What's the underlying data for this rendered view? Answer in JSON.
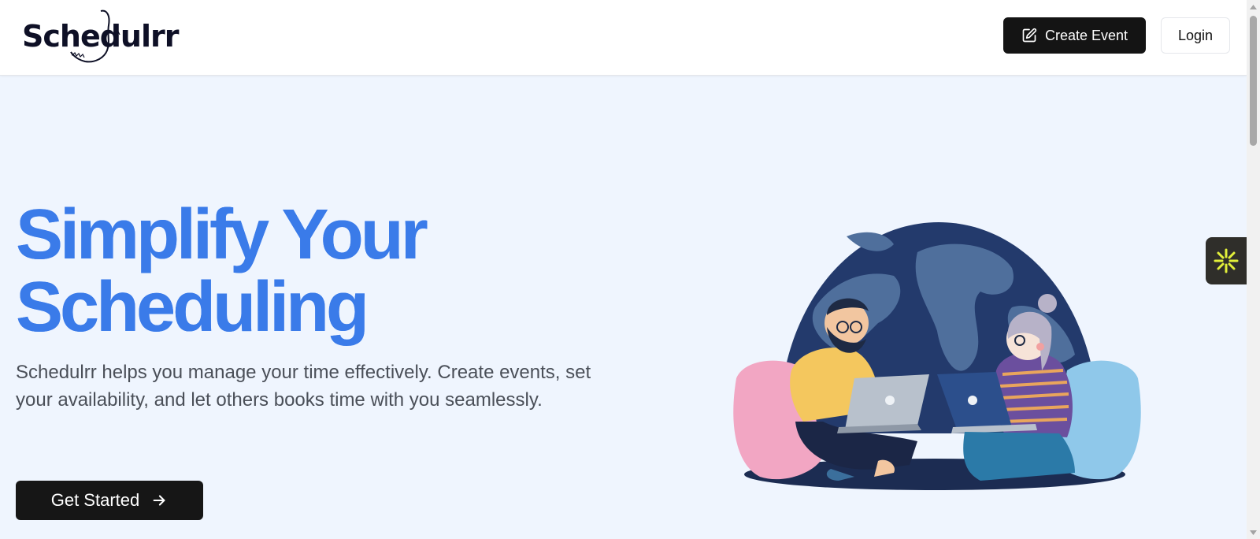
{
  "header": {
    "logo_text": "Schedulrr",
    "create_event_label": "Create Event",
    "login_label": "Login"
  },
  "hero": {
    "title_line1": "Simplify Your",
    "title_line2": "Scheduling",
    "description": "Schedulrr helps you manage your time effectively. Create events, set your availability, and let others books time with you seamlessly.",
    "cta_label": "Get Started"
  },
  "icons": {
    "create_event": "edit-icon",
    "cta_arrow": "arrow-right-icon",
    "side_widget": "asterisk-icon",
    "scroll_up": "chevron-up-icon",
    "scroll_down": "chevron-down-icon"
  },
  "colors": {
    "accent_blue": "#3a7be9",
    "button_dark": "#141414",
    "page_bg": "#eff5fe",
    "widget_bg": "#2f2e2a",
    "widget_icon": "#e2f03a"
  }
}
